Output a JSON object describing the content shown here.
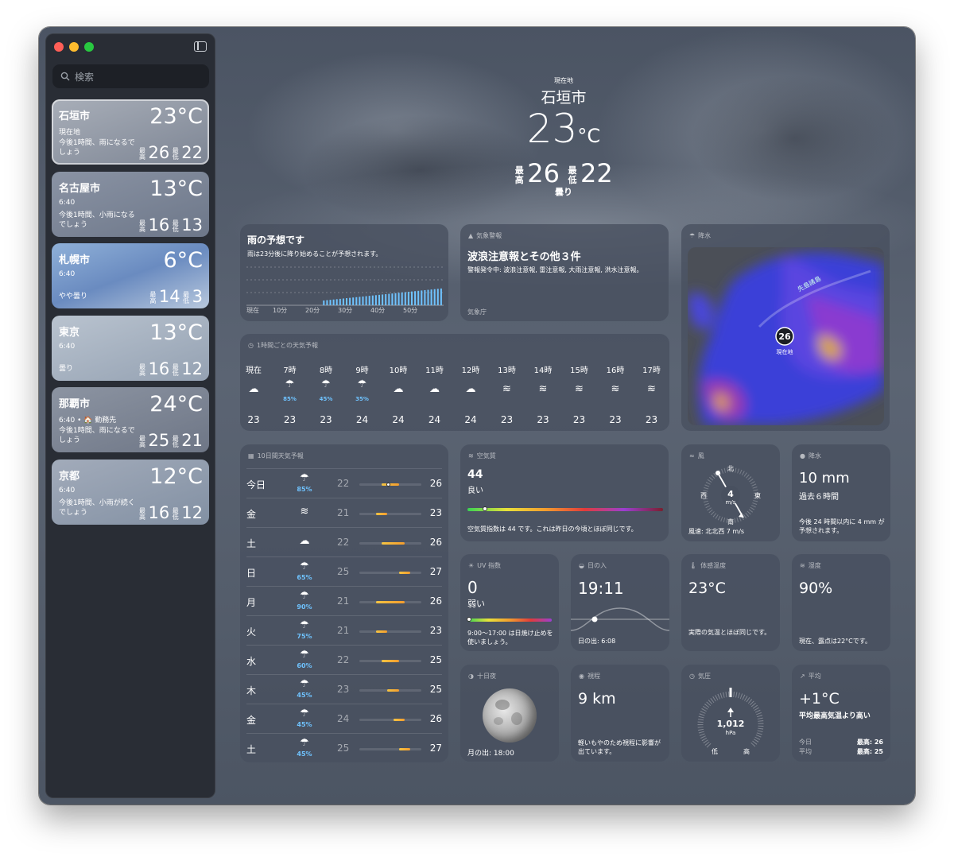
{
  "sidebar": {
    "search_placeholder": "検索",
    "cities": [
      {
        "name": "石垣市",
        "sub": "現在地",
        "temp": "23°C",
        "desc": "今後1時間、雨になるでしょう",
        "hi_label": "最高",
        "hi": "26",
        "lo_label": "最低",
        "lo": "22"
      },
      {
        "name": "名古屋市",
        "sub": "6:40",
        "temp": "13°C",
        "desc": "今後1時間、小雨になるでしょう",
        "hi_label": "最高",
        "hi": "16",
        "lo_label": "最低",
        "lo": "13"
      },
      {
        "name": "札幌市",
        "sub": "6:40",
        "temp": "6°C",
        "desc": "やや曇り",
        "hi_label": "最高",
        "hi": "14",
        "lo_label": "最低",
        "lo": "3"
      },
      {
        "name": "東京",
        "sub": "6:40",
        "temp": "13°C",
        "desc": "曇り",
        "hi_label": "最高",
        "hi": "16",
        "lo_label": "最低",
        "lo": "12"
      },
      {
        "name": "那覇市",
        "sub": "6:40 • 🏠 勤務先",
        "temp": "24°C",
        "desc": "今後1時間、雨になるでしょう",
        "hi_label": "最高",
        "hi": "25",
        "lo_label": "最低",
        "lo": "21"
      },
      {
        "name": "京都",
        "sub": "6:40",
        "temp": "12°C",
        "desc": "今後1時間、小雨が続くでしょう",
        "hi_label": "最高",
        "hi": "16",
        "lo_label": "最低",
        "lo": "12"
      }
    ]
  },
  "hero": {
    "label": "現在地",
    "city": "石垣市",
    "temp": "23",
    "unit": "°C",
    "hi_label": "最高",
    "hi": "26",
    "lo_label": "最低",
    "lo": "22",
    "condition": "曇り"
  },
  "rain": {
    "title": "雨の予想です",
    "desc": "雨は23分後に降り始めることが予想されます。",
    "ticks": [
      "現在",
      "10分",
      "20分",
      "30分",
      "40分",
      "50分"
    ]
  },
  "alert": {
    "header": "気象警報",
    "title": "波浪注意報とその他３件",
    "body": "警報発令中: 波浪注意報, 雷注意報, 大雨注意報, 洪水注意報。",
    "source": "気象庁"
  },
  "precip_map": {
    "header": "降水",
    "pin": "26",
    "pin_label": "現在地",
    "island_label": "先島諸島"
  },
  "hourly": {
    "header": "1時間ごとの天気予報",
    "items": [
      {
        "t": "現在",
        "i": "cloud",
        "p": "",
        "v": "23"
      },
      {
        "t": "7時",
        "i": "rain",
        "p": "85%",
        "v": "23"
      },
      {
        "t": "8時",
        "i": "rain",
        "p": "45%",
        "v": "23"
      },
      {
        "t": "9時",
        "i": "rain",
        "p": "35%",
        "v": "24"
      },
      {
        "t": "10時",
        "i": "cloud",
        "p": "",
        "v": "24"
      },
      {
        "t": "11時",
        "i": "cloud",
        "p": "",
        "v": "24"
      },
      {
        "t": "12時",
        "i": "cloud",
        "p": "",
        "v": "24"
      },
      {
        "t": "13時",
        "i": "wind",
        "p": "",
        "v": "23"
      },
      {
        "t": "14時",
        "i": "wind",
        "p": "",
        "v": "23"
      },
      {
        "t": "15時",
        "i": "wind",
        "p": "",
        "v": "23"
      },
      {
        "t": "16時",
        "i": "wind",
        "p": "",
        "v": "23"
      },
      {
        "t": "17時",
        "i": "wind",
        "p": "",
        "v": "23"
      }
    ]
  },
  "tenday": {
    "header": "10日間天気予報",
    "days": [
      {
        "d": "今日",
        "i": "rain",
        "p": "85%",
        "lo": "22",
        "hi": "26",
        "f0": 0.36,
        "f1": 0.64,
        "dot": 0.44
      },
      {
        "d": "金",
        "i": "wind",
        "p": "",
        "lo": "21",
        "hi": "23",
        "f0": 0.27,
        "f1": 0.45
      },
      {
        "d": "土",
        "i": "cloud",
        "p": "",
        "lo": "22",
        "hi": "26",
        "f0": 0.36,
        "f1": 0.73
      },
      {
        "d": "日",
        "i": "rain",
        "p": "65%",
        "lo": "25",
        "hi": "27",
        "f0": 0.64,
        "f1": 0.82
      },
      {
        "d": "月",
        "i": "rain",
        "p": "90%",
        "lo": "21",
        "hi": "26",
        "f0": 0.27,
        "f1": 0.73
      },
      {
        "d": "火",
        "i": "rain",
        "p": "75%",
        "lo": "21",
        "hi": "23",
        "f0": 0.27,
        "f1": 0.45
      },
      {
        "d": "水",
        "i": "rain",
        "p": "60%",
        "lo": "22",
        "hi": "25",
        "f0": 0.36,
        "f1": 0.64
      },
      {
        "d": "木",
        "i": "rain",
        "p": "45%",
        "lo": "23",
        "hi": "25",
        "f0": 0.45,
        "f1": 0.64
      },
      {
        "d": "金",
        "i": "rain",
        "p": "45%",
        "lo": "24",
        "hi": "26",
        "f0": 0.55,
        "f1": 0.73
      },
      {
        "d": "土",
        "i": "rain",
        "p": "45%",
        "lo": "25",
        "hi": "27",
        "f0": 0.64,
        "f1": 0.82
      }
    ]
  },
  "aq": {
    "header": "空気質",
    "value": "44",
    "level": "良い",
    "desc": "空気質指数は 44 です。これは昨日の今頃とほぼ同じです。",
    "fraction": 0.09
  },
  "wind": {
    "header": "風",
    "n": "北",
    "s": "南",
    "e": "東",
    "w": "西",
    "speed": "4",
    "unit": "m/s",
    "desc": "風速: 北北西 7 m/s"
  },
  "precip": {
    "header": "降水",
    "amount": "10 mm",
    "period": "過去６時間",
    "desc": "今後 24 時間以内に 4 mm が予想されます。"
  },
  "uv": {
    "header": "UV 指数",
    "value": "0",
    "level": "弱い",
    "desc": "9:00〜17:00 は日焼け止めを使いましょう。",
    "fraction": 0.02
  },
  "sunset": {
    "header": "日の入",
    "time": "19:11",
    "sunrise": "日の出: 6:08"
  },
  "feels": {
    "header": "体感温度",
    "value": "23°C",
    "desc": "実際の気温とほぼ同じです。"
  },
  "humidity": {
    "header": "湿度",
    "value": "90%",
    "desc": "現在、露点は22°Cです。"
  },
  "moon": {
    "header": "十日夜",
    "moonrise": "月の出: 18:00"
  },
  "visibility": {
    "header": "視程",
    "value": "9 km",
    "desc": "軽いもやのため視程に影響が出ています。"
  },
  "pressure": {
    "header": "気圧",
    "value": "1,012",
    "unit": "hPa",
    "low": "低",
    "high": "高"
  },
  "average": {
    "header": "平均",
    "value": "+1°C",
    "desc": "平均最高気温より高い",
    "today_label": "今日",
    "today_val": "最高: 26",
    "avg_label": "平均",
    "avg_val": "最高: 25"
  }
}
